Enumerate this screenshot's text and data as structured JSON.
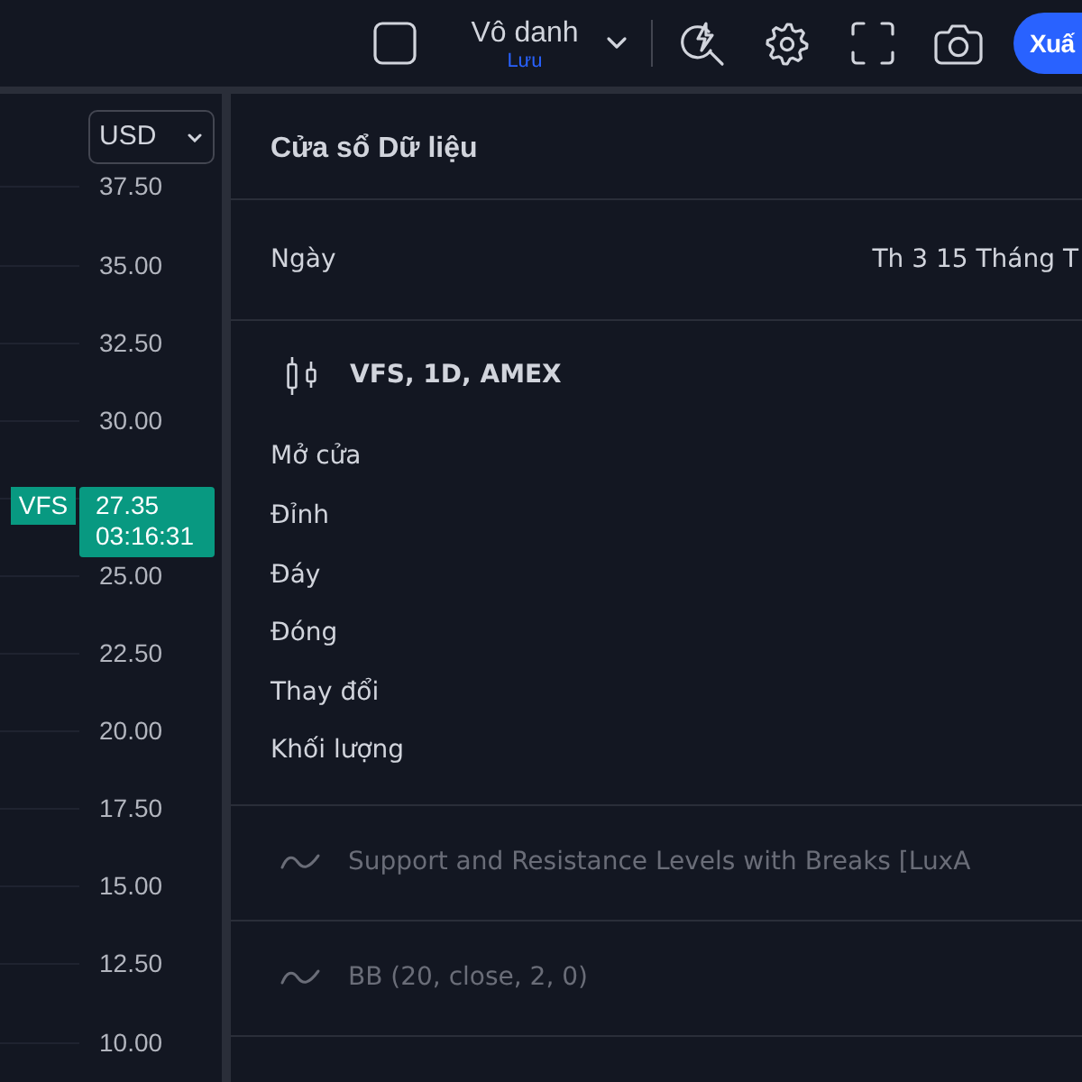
{
  "toolbar": {
    "layout_name": "Vô danh",
    "save_status": "Lưu",
    "publish_button": "Xuấ"
  },
  "chart": {
    "currency": "USD",
    "price_axis": [
      {
        "kind": "tick",
        "label": "37.50"
      },
      {
        "kind": "tick",
        "label": "35.00"
      },
      {
        "kind": "tick",
        "label": "32.50"
      },
      {
        "kind": "tick",
        "label": "30.00"
      },
      {
        "kind": "last_price",
        "symbol": "VFS",
        "price": "27.35",
        "countdown": "03:16:31"
      },
      {
        "kind": "tick",
        "label": "25.00"
      },
      {
        "kind": "tick",
        "label": "22.50"
      },
      {
        "kind": "tick",
        "label": "20.00"
      },
      {
        "kind": "tick",
        "label": "17.50"
      },
      {
        "kind": "tick",
        "label": "15.00"
      },
      {
        "kind": "tick",
        "label": "12.50"
      },
      {
        "kind": "tick",
        "label": "10.00"
      }
    ]
  },
  "data_window": {
    "title": "Cửa sổ Dữ liệu",
    "date": {
      "label": "Ngày",
      "value": "Th 3 15 Tháng T"
    },
    "series": {
      "title": "VFS, 1D, AMEX",
      "fields": [
        "Mở cửa",
        "Đỉnh",
        "Đáy",
        "Đóng",
        "Thay đổi",
        "Khối lượng"
      ]
    },
    "indicators": [
      "Support and Resistance Levels with Breaks [LuxA",
      "BB (20, close, 2, 0)"
    ]
  }
}
